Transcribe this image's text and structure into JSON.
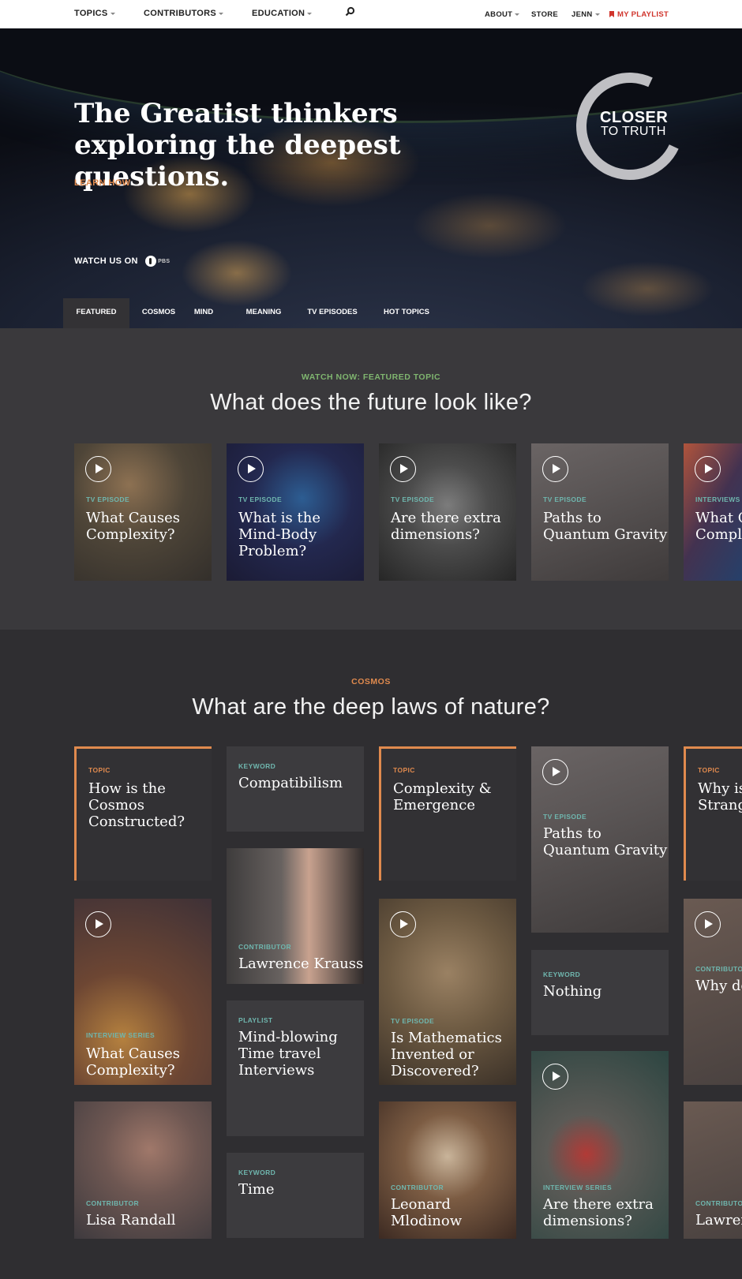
{
  "nav": {
    "topics": "TOPICS",
    "contributors": "CONTRIBUTORS",
    "education": "EDUCATION",
    "about": "ABOUT",
    "store": "STORE",
    "user": "JENN",
    "playlist": "MY PLAYLIST"
  },
  "hero": {
    "headline": "The Greatist thinkers exploring the deepest questions.",
    "learn_how": "LEARN HOW",
    "watch_us_on": "WATCH US ON",
    "pbs": "PBS",
    "logo_line1": "CLOSER",
    "logo_line2": "TO TRUTH"
  },
  "tabs": [
    "FEATURED",
    "COSMOS",
    "MIND",
    "MEANING",
    "TV EPISODES",
    "HOT TOPICS"
  ],
  "featured": {
    "eyebrow": "WATCH NOW: FEATURED TOPIC",
    "heading": "What does the future look like?",
    "cards": [
      {
        "tag": "TV EPISODE",
        "title": "What Causes Complexity?"
      },
      {
        "tag": "TV EPISODE",
        "title": "What is the Mind-Body Problem?"
      },
      {
        "tag": "TV EPISODE",
        "title": "Are there extra dimensions?"
      },
      {
        "tag": "TV EPISODE",
        "title": "Paths to Quantum Gravity"
      },
      {
        "tag": "INTERVIEWS",
        "title": "What Causes Complexity?"
      }
    ]
  },
  "cosmos": {
    "eyebrow": "COSMOS",
    "heading": "What are the deep laws of nature?",
    "cards": [
      {
        "tag": "TOPIC",
        "title": "How is the Cosmos Constructed?"
      },
      {
        "tag": "KEYWORD",
        "title": "Compatibilism"
      },
      {
        "tag": "TOPIC",
        "title": "Complexity & Emergence"
      },
      {
        "tag": "TV EPISODE",
        "title": "Paths to Quantum Gravity"
      },
      {
        "tag": "TOPIC",
        "title": "Why is Quantum Strange?"
      },
      {
        "tag": "CONTRIBUTOR",
        "title": "Lawrence Krauss"
      },
      {
        "tag": "INTERVIEW SERIES",
        "title": "What Causes Complexity?"
      },
      {
        "tag": "TV EPISODE",
        "title": "Is Mathematics Invented or Discovered?"
      },
      {
        "tag": "KEYWORD",
        "title": "Nothing"
      },
      {
        "tag": "CONTRIBUTOR",
        "title": "Why do for sym"
      },
      {
        "tag": "PLAYLIST",
        "title": "Mind-blowing Time travel Interviews"
      },
      {
        "tag": "CONTRIBUTOR",
        "title": "Lisa Randall"
      },
      {
        "tag": "KEYWORD",
        "title": "Time"
      },
      {
        "tag": "CONTRIBUTOR",
        "title": "Leonard Mlodinow"
      },
      {
        "tag": "INTERVIEW SERIES",
        "title": "Are there extra dimensions?"
      },
      {
        "tag": "CONTRIBUTOR",
        "title": "Lawren"
      }
    ]
  },
  "colors": {
    "accent_orange": "#e08a4e",
    "tag_teal": "#6fb6ae",
    "eyebrow_green": "#7fb56f",
    "playlist_red": "#d0342c"
  }
}
